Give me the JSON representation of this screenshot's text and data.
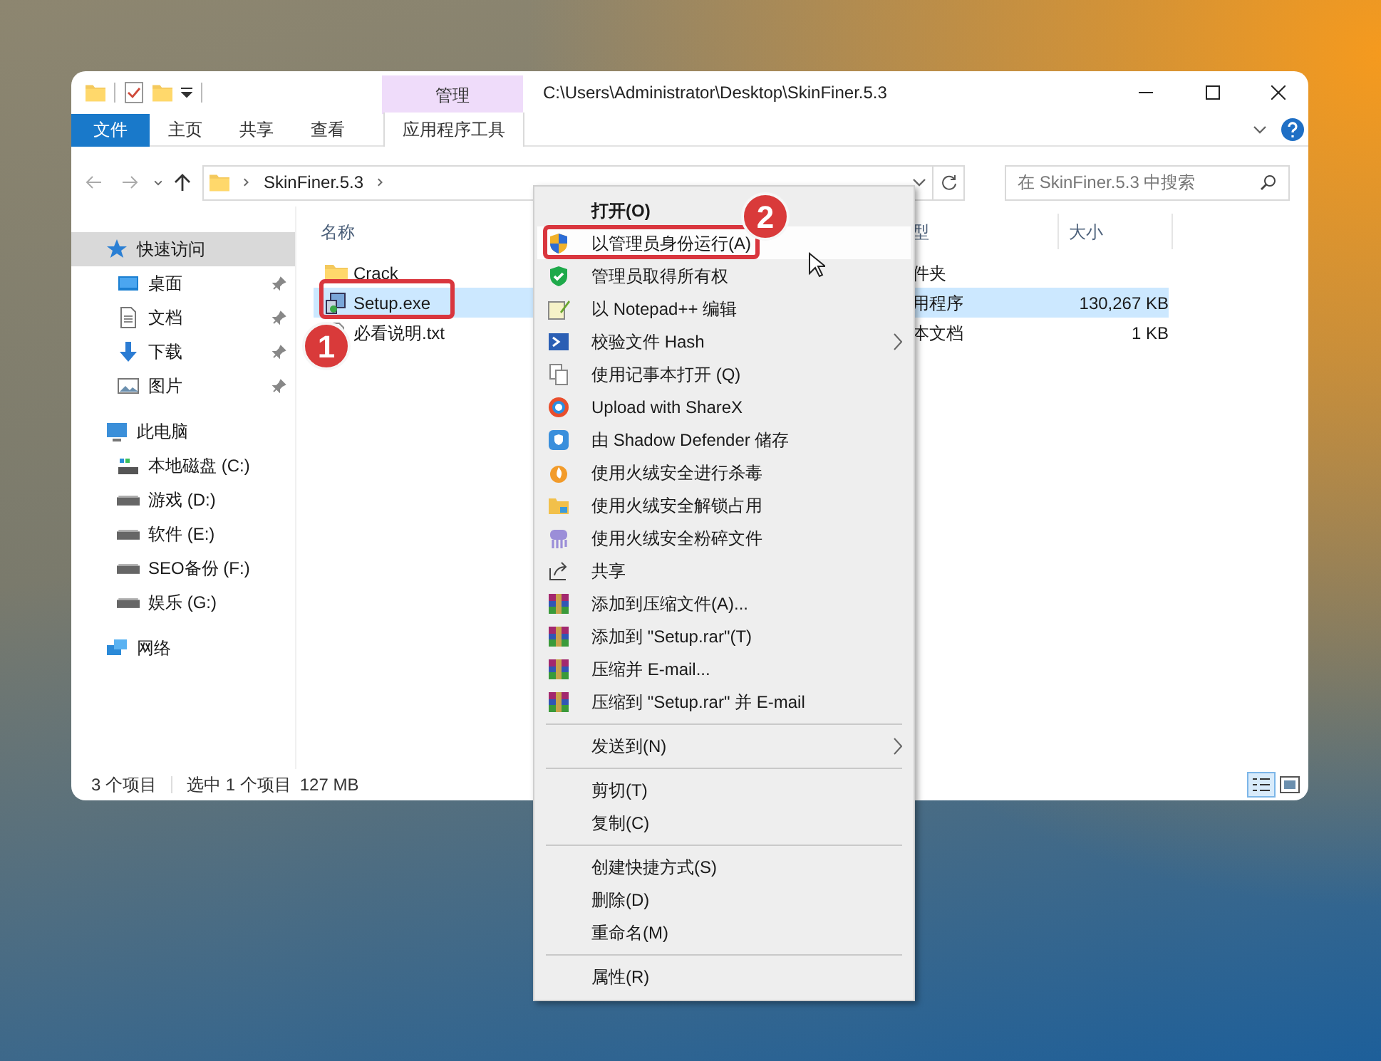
{
  "title_bar": {
    "contextual_tab": "管理",
    "path": "C:\\Users\\Administrator\\Desktop\\SkinFiner.5.3"
  },
  "ribbon_tabs": [
    {
      "label": "文件",
      "kind": "file"
    },
    {
      "label": "主页",
      "kind": "tab"
    },
    {
      "label": "共享",
      "kind": "tab"
    },
    {
      "label": "查看",
      "kind": "tab"
    },
    {
      "label": "应用程序工具",
      "kind": "contextual"
    }
  ],
  "address_bar": {
    "crumbs": [
      "SkinFiner.5.3"
    ]
  },
  "search": {
    "placeholder": "在 SkinFiner.5.3 中搜索"
  },
  "navigation": [
    {
      "label": "快速访问",
      "kind": "star",
      "selected": true,
      "children": [
        {
          "label": "桌面",
          "kind": "desktop",
          "pinned": true,
          "selected": false
        },
        {
          "label": "文档",
          "kind": "document",
          "pinned": true,
          "selected": false
        },
        {
          "label": "下载",
          "kind": "download",
          "pinned": true,
          "selected": false
        },
        {
          "label": "图片",
          "kind": "picture",
          "pinned": true,
          "selected": false
        }
      ]
    },
    {
      "label": "此电脑",
      "kind": "computer",
      "selected": false,
      "children": [
        {
          "label": "本地磁盘 (C:)",
          "kind": "system-drive",
          "pinned": false,
          "selected": false
        },
        {
          "label": "游戏 (D:)",
          "kind": "drive",
          "pinned": false,
          "selected": false
        },
        {
          "label": "软件 (E:)",
          "kind": "drive",
          "pinned": false,
          "selected": false
        },
        {
          "label": "SEO备份 (F:)",
          "kind": "drive",
          "pinned": false,
          "selected": false
        },
        {
          "label": "娱乐 (G:)",
          "kind": "drive",
          "pinned": false,
          "selected": false
        }
      ]
    },
    {
      "label": "网络",
      "kind": "network",
      "selected": false
    }
  ],
  "file_list": {
    "columns": [
      "名称",
      "型",
      "大小"
    ],
    "rows": [
      {
        "name": "Crack",
        "kind": "folder",
        "selected": false,
        "type": "件夹"
      },
      {
        "name": "Setup.exe",
        "kind": "exe",
        "selected": true,
        "type": "用程序",
        "size": "130,267 KB"
      },
      {
        "name": "必看说明.txt",
        "kind": "txt",
        "selected": false,
        "type": "本文档",
        "size": "1 KB"
      }
    ]
  },
  "status_bar": {
    "item_count": "3 个项目",
    "selection": "选中 1 个项目",
    "selection_size": "127 MB"
  },
  "context_menu": {
    "items": [
      {
        "label": "打开(O)",
        "kind": "plain",
        "default": true,
        "selected": false,
        "submenu": false
      },
      {
        "label": "以管理员身份运行(A)",
        "kind": "shield",
        "default": false,
        "selected": true,
        "submenu": false
      },
      {
        "label": "管理员取得所有权",
        "kind": "check-shield",
        "default": false,
        "selected": false,
        "submenu": false
      },
      {
        "label": "以 Notepad++ 编辑",
        "kind": "notepad",
        "default": false,
        "selected": false,
        "submenu": false
      },
      {
        "label": "校验文件 Hash",
        "kind": "terminal",
        "default": false,
        "selected": false,
        "submenu": true
      },
      {
        "label": "使用记事本打开 (Q)",
        "kind": "pages",
        "default": false,
        "selected": false,
        "submenu": false
      },
      {
        "label": "Upload with ShareX",
        "kind": "ring",
        "default": false,
        "selected": false,
        "submenu": false
      },
      {
        "label": "由 Shadow Defender 储存",
        "kind": "defender",
        "default": false,
        "selected": false,
        "submenu": false
      },
      {
        "label": "使用火绒安全进行杀毒",
        "kind": "flame",
        "default": false,
        "selected": false,
        "submenu": false
      },
      {
        "label": "使用火绒安全解锁占用",
        "kind": "folder",
        "default": false,
        "selected": false,
        "submenu": false
      },
      {
        "label": "使用火绒安全粉碎文件",
        "kind": "shredder",
        "default": false,
        "selected": false,
        "submenu": false
      },
      {
        "label": "共享",
        "kind": "share",
        "default": false,
        "selected": false,
        "submenu": false
      },
      {
        "label": "添加到压缩文件(A)...",
        "kind": "archive",
        "default": false,
        "selected": false,
        "submenu": false
      },
      {
        "label": "添加到 \"Setup.rar\"(T)",
        "kind": "archive",
        "default": false,
        "selected": false,
        "submenu": false
      },
      {
        "label": "压缩并 E-mail...",
        "kind": "archive",
        "default": false,
        "selected": false,
        "submenu": false
      },
      {
        "label": "压缩到 \"Setup.rar\" 并 E-mail",
        "kind": "archive",
        "default": false,
        "selected": false,
        "submenu": false
      },
      {
        "kind": "separator"
      },
      {
        "label": "发送到(N)",
        "kind": "plain",
        "default": false,
        "selected": false,
        "submenu": true
      },
      {
        "kind": "separator"
      },
      {
        "label": "剪切(T)",
        "kind": "plain",
        "default": false,
        "selected": false,
        "submenu": false
      },
      {
        "label": "复制(C)",
        "kind": "plain",
        "default": false,
        "selected": false,
        "submenu": false
      },
      {
        "kind": "separator"
      },
      {
        "label": "创建快捷方式(S)",
        "kind": "plain",
        "default": false,
        "selected": false,
        "submenu": false
      },
      {
        "label": "删除(D)",
        "kind": "plain",
        "default": false,
        "selected": false,
        "submenu": false
      },
      {
        "label": "重命名(M)",
        "kind": "plain",
        "default": false,
        "selected": false,
        "submenu": false
      },
      {
        "kind": "separator"
      },
      {
        "label": "属性(R)",
        "kind": "plain",
        "default": false,
        "selected": false,
        "submenu": false
      }
    ]
  },
  "annotations": [
    {
      "label": "1"
    },
    {
      "label": "2"
    }
  ]
}
